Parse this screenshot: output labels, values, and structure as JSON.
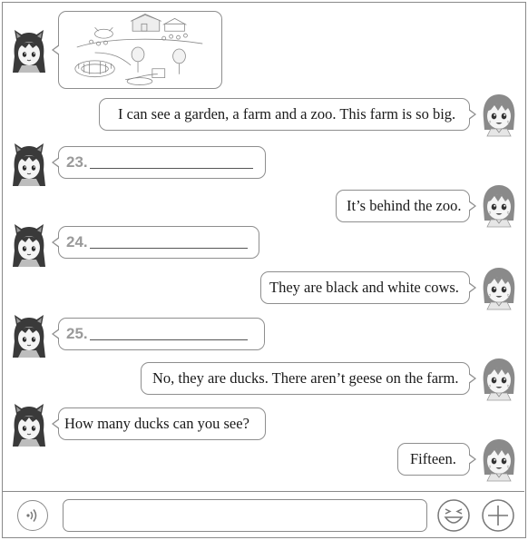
{
  "messages": [
    {
      "side": "left",
      "kind": "image",
      "description": "farm-scene"
    },
    {
      "side": "right",
      "text": "I can see a garden, a farm and a zoo. This farm is so big."
    },
    {
      "side": "left",
      "kind": "blank",
      "number": "23."
    },
    {
      "side": "right",
      "text": "It’s behind the zoo."
    },
    {
      "side": "left",
      "kind": "blank",
      "number": "24."
    },
    {
      "side": "right",
      "text": "They are black and white cows."
    },
    {
      "side": "left",
      "kind": "blank",
      "number": "25."
    },
    {
      "side": "right",
      "text": "No, they are ducks. There aren’t geese on the farm."
    },
    {
      "side": "left",
      "text": "How many ducks can you see?"
    },
    {
      "side": "right",
      "text": "Fifteen."
    }
  ],
  "input": {
    "value": "",
    "placeholder": ""
  },
  "icons": {
    "voice": "voice-icon",
    "emoji": "emoji-icon",
    "more": "plus-icon"
  },
  "colors": {
    "border": "#8e8e8e",
    "blank_number": "#9a9a9a"
  }
}
